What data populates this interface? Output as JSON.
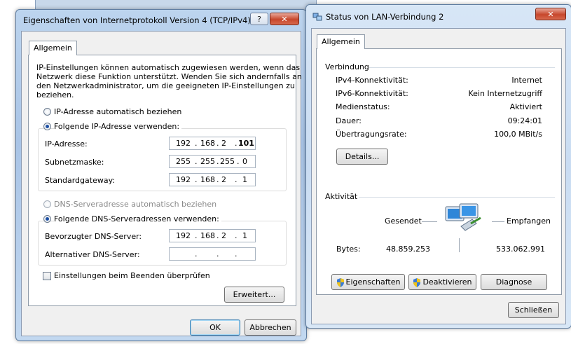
{
  "ipv4_dialog": {
    "title": "Eigenschaften von Internetprotokoll Version 4 (TCP/IPv4)",
    "help_label": "?",
    "close_label": "✕",
    "tab_general": "Allgemein",
    "description": [
      "IP-Einstellungen können automatisch zugewiesen werden, wenn das",
      "Netzwerk diese Funktion unterstützt. Wenden Sie sich andernfalls an",
      "den Netzwerkadministrator, um die geeigneten IP-Einstellungen zu",
      "beziehen."
    ],
    "radio_ip_auto": "IP-Adresse automatisch beziehen",
    "radio_ip_manual": "Folgende IP-Adresse verwenden:",
    "ip_address_label": "IP-Adresse:",
    "ip_address": [
      "192",
      "168",
      "2",
      "101"
    ],
    "subnet_label": "Subnetzmaske:",
    "subnet": [
      "255",
      "255",
      "255",
      "0"
    ],
    "gateway_label": "Standardgateway:",
    "gateway": [
      "192",
      "168",
      "2",
      "1"
    ],
    "radio_dns_auto": "DNS-Serveradresse automatisch beziehen",
    "radio_dns_manual": "Folgende DNS-Serveradressen verwenden:",
    "preferred_dns_label": "Bevorzugter DNS-Server:",
    "preferred_dns": [
      "192",
      "168",
      "2",
      "1"
    ],
    "alternate_dns_label": "Alternativer DNS-Server:",
    "alternate_dns": [
      "",
      "",
      "",
      ""
    ],
    "validate_label": "Einstellungen beim Beenden überprüfen",
    "advanced_label": "Erweitert...",
    "ok_label": "OK",
    "cancel_label": "Abbrechen"
  },
  "status_dialog": {
    "title": "Status von LAN-Verbindung 2",
    "close_label": "✕",
    "tab_general": "Allgemein",
    "connection_heading": "Verbindung",
    "rows": [
      {
        "label": "IPv4-Konnektivität:",
        "value": "Internet"
      },
      {
        "label": "IPv6-Konnektivität:",
        "value": "Kein Internetzugriff"
      },
      {
        "label": "Medienstatus:",
        "value": "Aktiviert"
      },
      {
        "label": "Dauer:",
        "value": "09:24:01"
      },
      {
        "label": "Übertragungsrate:",
        "value": "100,0 MBit/s"
      }
    ],
    "details_label": "Details...",
    "activity_heading": "Aktivität",
    "sent_label": "Gesendet",
    "received_label": "Empfangen",
    "bytes_label": "Bytes:",
    "bytes_sent": "48.859.253",
    "bytes_received": "533.062.991",
    "properties_label": "Eigenschaften",
    "deactivate_label": "Deaktivieren",
    "diagnose_label": "Diagnose",
    "close_button_label": "Schließen"
  },
  "colors": {
    "accent": "#1d4fa3",
    "title_bar": "#bcd4ee"
  },
  "icons": [
    "network-icon",
    "help-icon",
    "close-icon",
    "shield-icon",
    "network-computers-icon"
  ]
}
